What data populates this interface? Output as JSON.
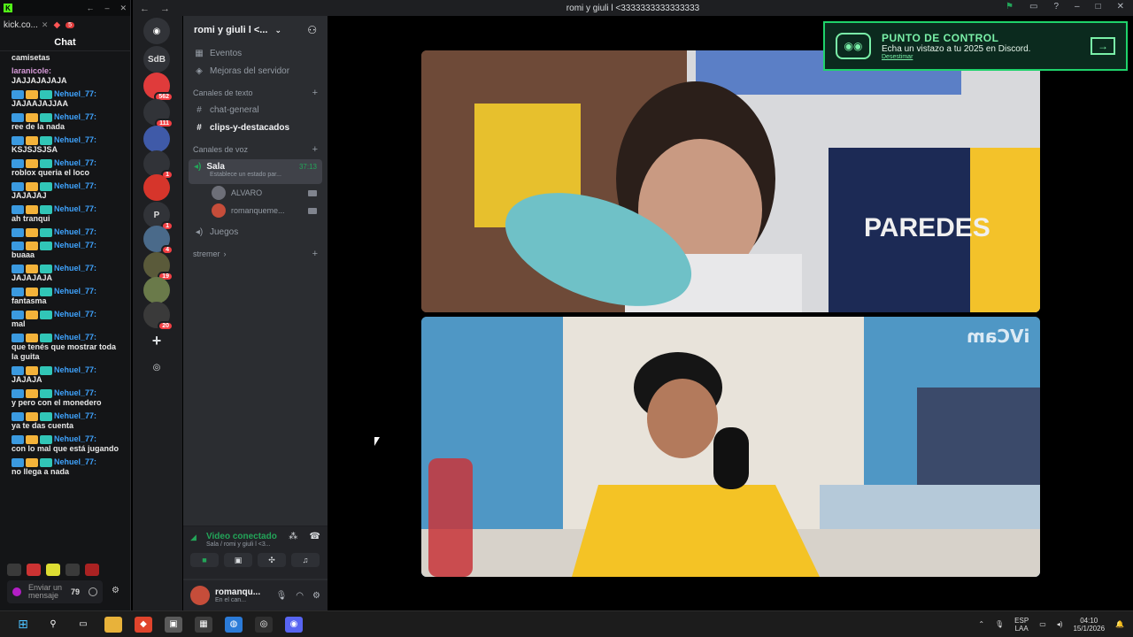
{
  "kick": {
    "tab_label": "kick.co...",
    "notif_count": "5",
    "chat_title": "Chat",
    "messages": [
      {
        "user": "",
        "text": "camisetas"
      },
      {
        "user": "laranicole:",
        "text": "JAJJAJAJAJA",
        "pink": true
      },
      {
        "user": "Nehuel_77:",
        "text": "JAJAAJAJJAA"
      },
      {
        "user": "Nehuel_77:",
        "text": "ree de la nada"
      },
      {
        "user": "Nehuel_77:",
        "text": "KSJSJSJSA"
      },
      {
        "user": "Nehuel_77:",
        "text": "roblox queria el loco"
      },
      {
        "user": "Nehuel_77:",
        "text": "JAJAJAJ"
      },
      {
        "user": "Nehuel_77:",
        "text": "ah tranqui"
      },
      {
        "user": "Nehuel_77:",
        "text": ""
      },
      {
        "user": "Nehuel_77:",
        "text": "buaaa"
      },
      {
        "user": "Nehuel_77:",
        "text": "JAJAJAJA"
      },
      {
        "user": "Nehuel_77:",
        "text": "fantasma"
      },
      {
        "user": "Nehuel_77:",
        "text": "mal"
      },
      {
        "user": "Nehuel_77:",
        "text": "que tenés que mostrar toda la guita"
      },
      {
        "user": "Nehuel_77:",
        "text": "JAJAJA"
      },
      {
        "user": "Nehuel_77:",
        "text": "y pero con el monedero"
      },
      {
        "user": "Nehuel_77:",
        "text": "ya te das cuenta"
      },
      {
        "user": "Nehuel_77:",
        "text": "con lo mal que está jugando"
      },
      {
        "user": "Nehuel_77:",
        "text": "no llega a nada"
      }
    ],
    "send_placeholder": "Enviar un mensaje",
    "send_count": "79"
  },
  "window_title": "romi y giuli l <3333333333333333",
  "rail": [
    {
      "label": "SdB",
      "badge": ""
    },
    {
      "label": "",
      "badge": "562"
    },
    {
      "label": "",
      "badge": "111"
    },
    {
      "label": "",
      "badge": ""
    },
    {
      "label": "",
      "badge": "1"
    },
    {
      "label": "",
      "badge": ""
    },
    {
      "label": "P",
      "badge": "1"
    },
    {
      "label": "",
      "badge": "4"
    },
    {
      "label": "",
      "badge": "19"
    },
    {
      "label": "",
      "badge": ""
    },
    {
      "label": "",
      "badge": "20"
    }
  ],
  "server": {
    "name": "romi y giuli l <...",
    "events": "Eventos",
    "boosts": "Mejoras del servidor",
    "text_category": "Canales de texto",
    "text_channels": [
      "chat-general",
      "clips-y-destacados"
    ],
    "voice_category": "Canales de voz",
    "voice_channel": "Sala",
    "voice_timer": "37:13",
    "voice_status": "Establece un estado par...",
    "voice_users": [
      "ALVARO",
      "romanqueme..."
    ],
    "other_voice": "Juegos",
    "streamer_category": "stremer"
  },
  "voice_panel": {
    "title": "Video conectado",
    "subtitle": "Sala / romi y giuli l <3..."
  },
  "user_panel": {
    "name": "romanqu...",
    "status": "En el can..."
  },
  "checkpoint": {
    "title": "PUNTO DE CONTROL",
    "subtitle": "Echa un vistazo a tu 2025 en Discord.",
    "link": "Desestimar"
  },
  "video": {
    "watermark": "iVCam"
  },
  "taskbar": {
    "lang_top": "ESP",
    "lang_bottom": "LAA",
    "time": "04:10",
    "date": "15/1/2026"
  }
}
